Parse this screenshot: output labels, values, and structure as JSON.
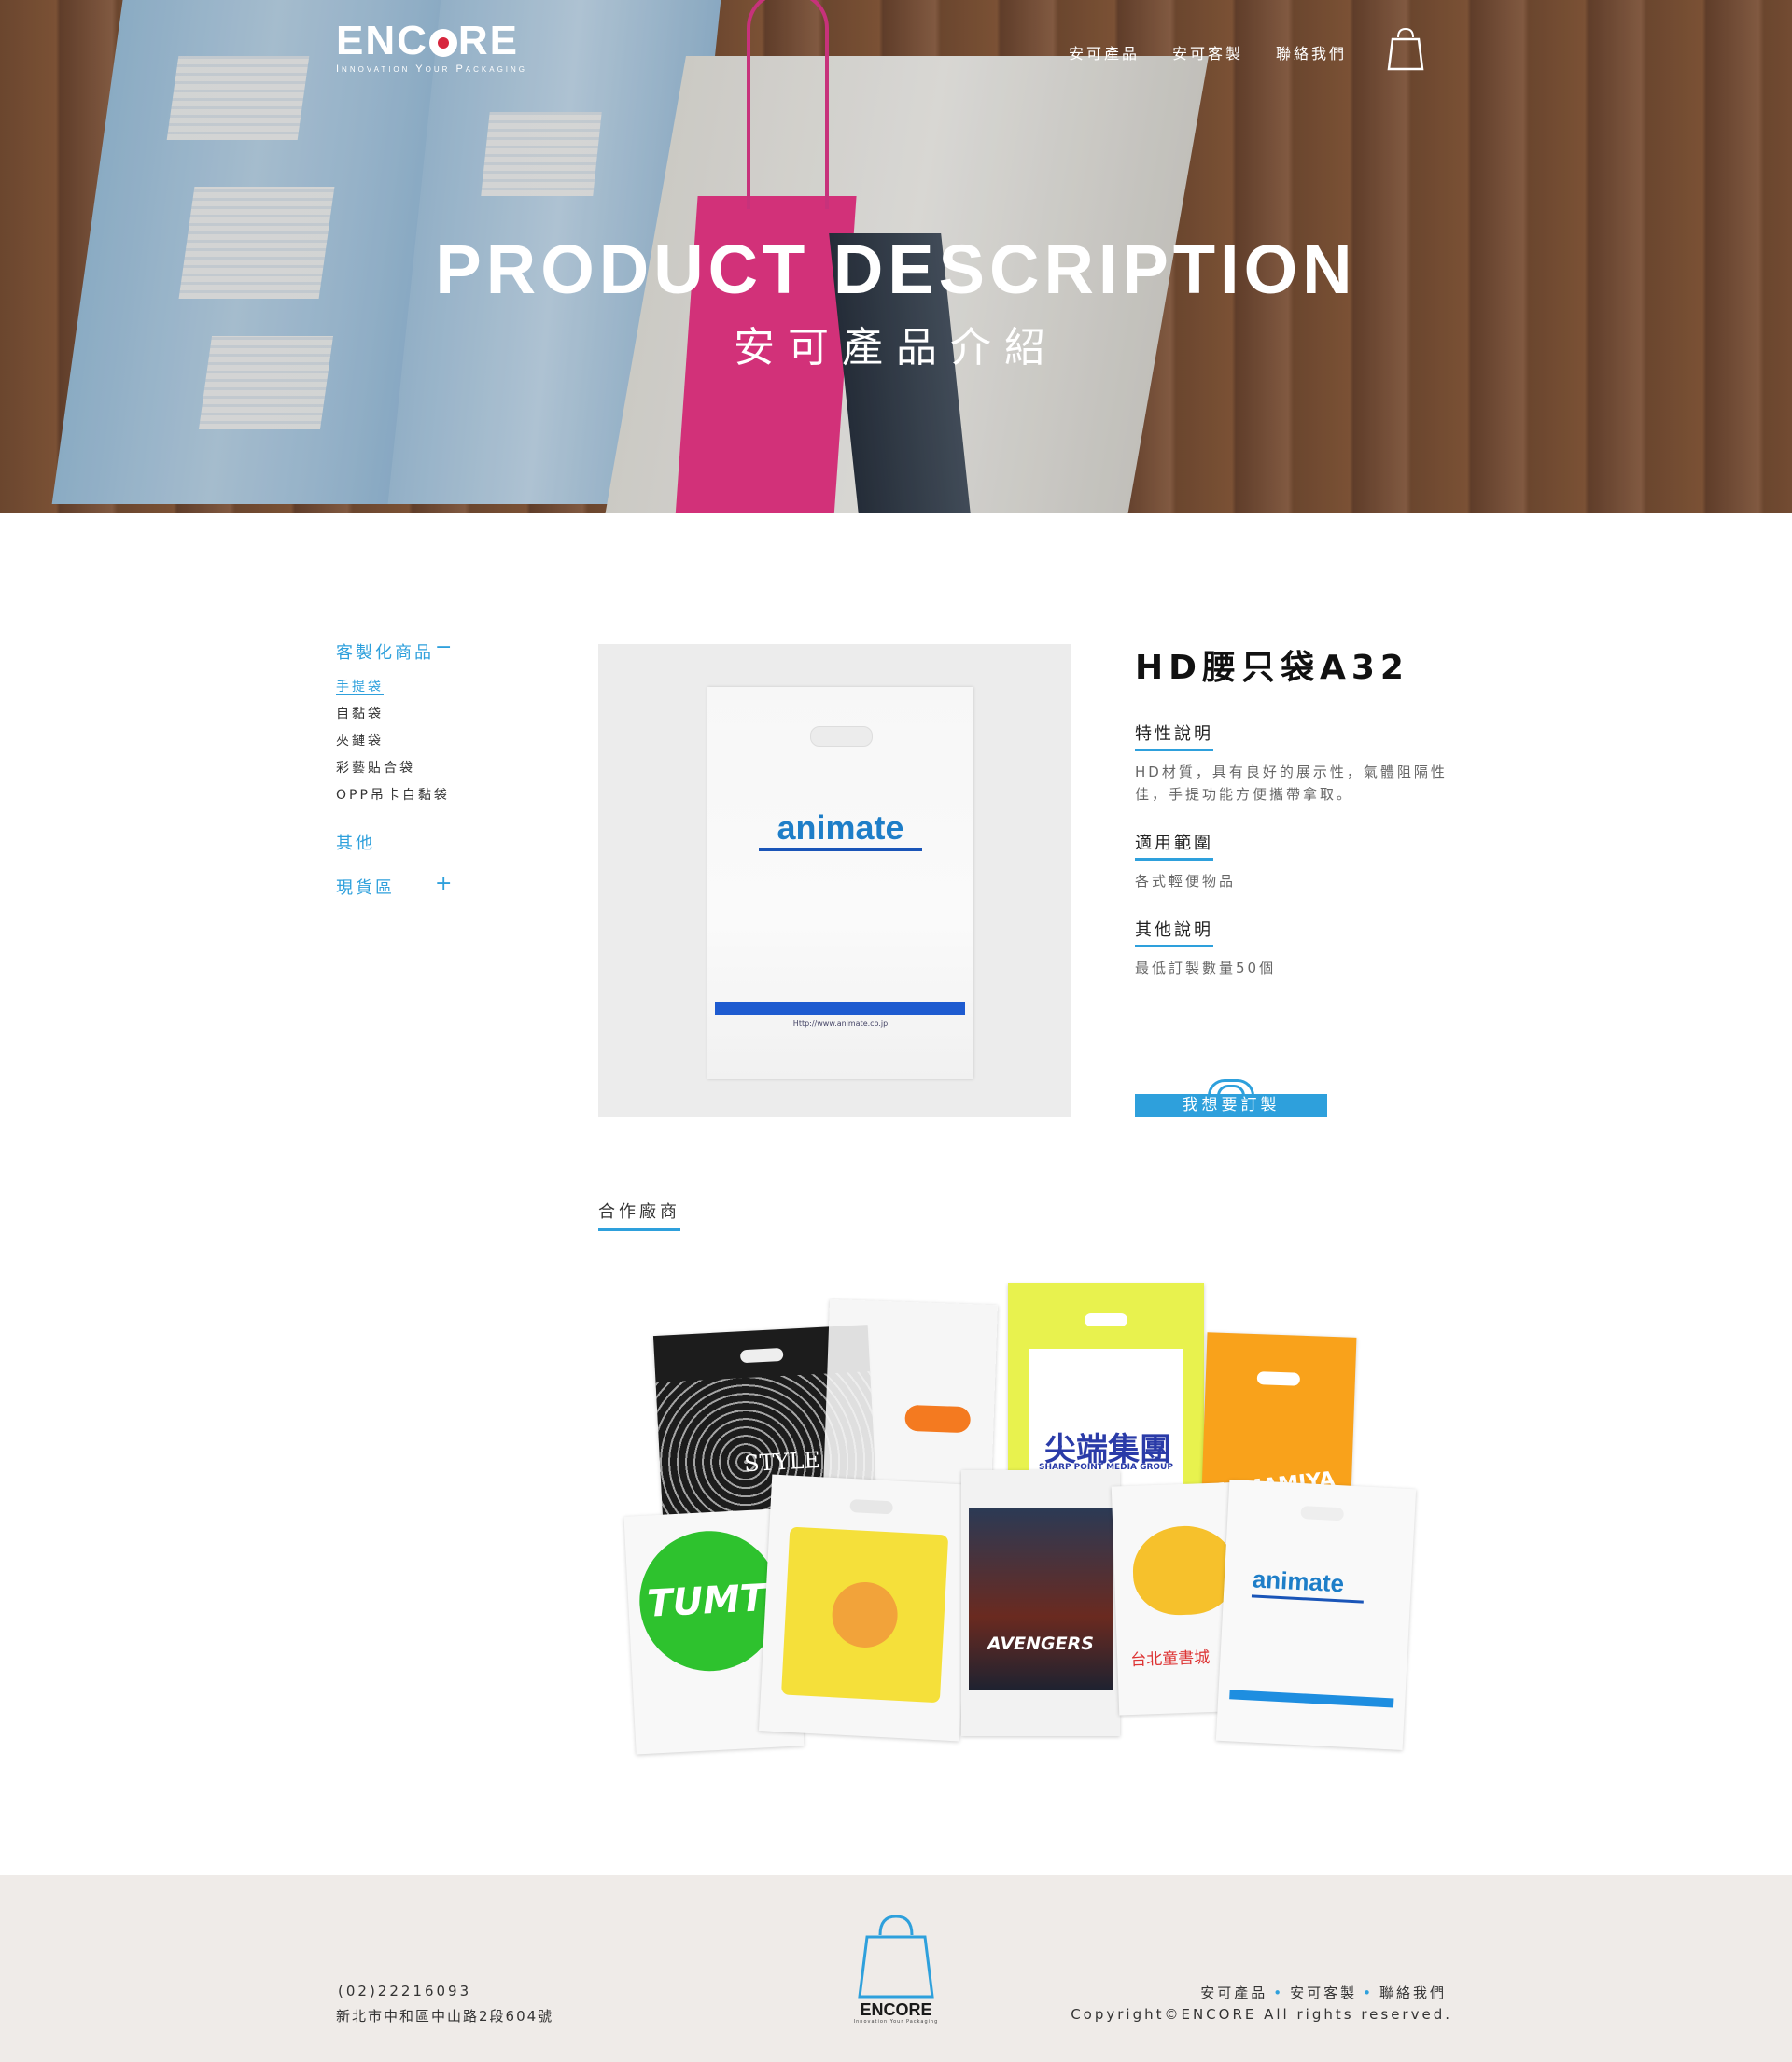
{
  "header": {
    "logo_word": "ENCORE",
    "logo_tagline": "Innovation Your Packaging",
    "nav": [
      "安可產品",
      "安可客製",
      "聯絡我們"
    ],
    "cart_icon": "shopping-bag-icon"
  },
  "hero": {
    "title": "PRODUCT DESCRIPTION",
    "subtitle": "安可產品介紹"
  },
  "sidebar": {
    "categories": [
      {
        "label": "客製化商品",
        "toggle": "−",
        "expanded": true,
        "items": [
          "手提袋",
          "自黏袋",
          "夾鏈袋",
          "彩藝貼合袋",
          "OPP吊卡自黏袋"
        ],
        "active_item": "手提袋"
      },
      {
        "label": "其他",
        "toggle": ""
      },
      {
        "label": "現貨區",
        "toggle": "+"
      }
    ]
  },
  "product": {
    "title": "HD腰只袋A32",
    "image_brand": "animate",
    "image_url_text": "Http://www.animate.co.jp",
    "sections": [
      {
        "heading": "特性說明",
        "text": "HD材質，具有良好的展示性，氣體阻隔性佳，手提功能方便攜帶拿取。"
      },
      {
        "heading": "適用範圍",
        "text": "各式輕便物品"
      },
      {
        "heading": "其他說明",
        "text": "最低訂製數量50個"
      }
    ],
    "order_button": "我想要訂製"
  },
  "partners": {
    "heading": "合作廠商",
    "bag_labels": [
      "STYLE",
      "尖端集團",
      "SHARP POINT MEDIA GROUP",
      "MAMAMIYA",
      "TUMT",
      "AVENGERS",
      "台北童書城",
      "animate"
    ]
  },
  "footer": {
    "phone": "(02)22216093",
    "address": "新北市中和區中山路2段604號",
    "links": [
      "安可產品",
      "安可客製",
      "聯絡我們"
    ],
    "copyright": "Copyright©ENCORE All rights reserved.",
    "logo_word": "ENCORE",
    "logo_tagline": "Innovation Your Packaging"
  },
  "colors": {
    "accent": "#2ea0dc",
    "logo_dot": "#d7263d",
    "footer_bg": "#efebe8"
  }
}
